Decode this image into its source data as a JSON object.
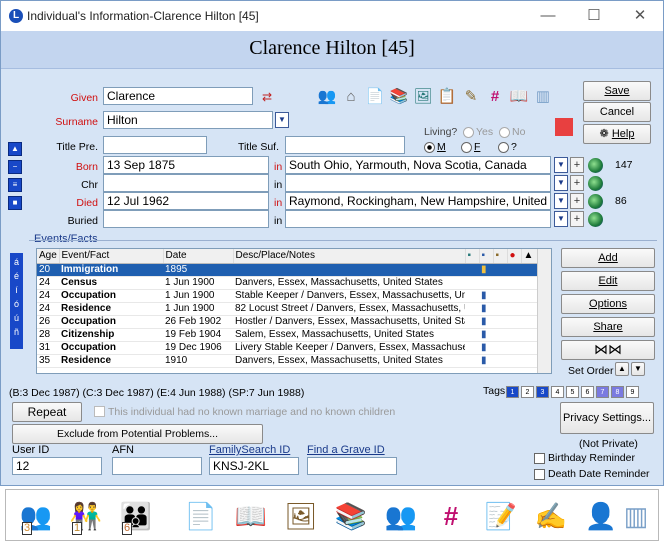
{
  "window": {
    "title": "Individual's Information-Clarence Hilton [45]",
    "banner_name": "Clarence Hilton [45]",
    "minimize": "—",
    "maximize": "☐",
    "close": "✕"
  },
  "person": {
    "given_label": "Given",
    "given_value": "Clarence",
    "surname_label": "Surname",
    "surname_value": "Hilton",
    "title_pre_label": "Title Pre.",
    "title_pre_value": "",
    "title_suf_label": "Title Suf.",
    "title_suf_value": "",
    "living_label": "Living?",
    "living_yes": "Yes",
    "living_no": "No",
    "sex_m": "M",
    "sex_f": "F",
    "sex_unknown": "?"
  },
  "events_top": [
    {
      "label": "Born",
      "date": "13 Sep 1875",
      "in": "in",
      "place": "South Ohio, Yarmouth, Nova Scotia, Canada",
      "count": "147"
    },
    {
      "label": "Chr",
      "date": "",
      "in": "in",
      "place": "",
      "count": ""
    },
    {
      "label": "Died",
      "date": "12 Jul 1962",
      "in": "in",
      "place": "Raymond, Rockingham, New Hampshire, United States",
      "count": "86"
    },
    {
      "label": "Buried",
      "date": "",
      "in": "in",
      "place": "",
      "count": ""
    }
  ],
  "buttons": {
    "save": "Save",
    "cancel": "Cancel",
    "help": "Help",
    "add": "Add",
    "edit": "Edit",
    "options": "Options",
    "share": "Share",
    "set_order": "Set Order",
    "repeat": "Repeat",
    "exclude": "Exclude from Potential Problems...",
    "privacy": "Privacy Settings..."
  },
  "events_section": {
    "title": "Events/Facts",
    "columns": [
      "Age",
      "Event/Fact",
      "Date",
      "Desc/Place/Notes"
    ],
    "rows": [
      {
        "age": "20",
        "event": "Immigration",
        "date": "1895",
        "desc": "",
        "selected": true
      },
      {
        "age": "24",
        "event": "Census",
        "date": "1 Jun 1900",
        "desc": "Danvers, Essex, Massachusetts, United States"
      },
      {
        "age": "24",
        "event": "Occupation",
        "date": "1 Jun 1900",
        "desc": "Stable Keeper / Danvers, Essex, Massachusetts, United"
      },
      {
        "age": "24",
        "event": "Residence",
        "date": "1 Jun 1900",
        "desc": "82 Locust Street / Danvers, Essex, Massachusetts, Unit"
      },
      {
        "age": "26",
        "event": "Occupation",
        "date": "26 Feb 1902",
        "desc": "Hostler / Danvers, Essex, Massachusetts, United States"
      },
      {
        "age": "28",
        "event": "Citizenship",
        "date": "19 Feb 1904",
        "desc": "Salem, Essex, Massachusetts, United States"
      },
      {
        "age": "31",
        "event": "Occupation",
        "date": "19 Dec 1906",
        "desc": "Livery Stable Keeper / Danvers, Essex, Massachusetts,"
      },
      {
        "age": "35",
        "event": "Residence",
        "date": "1910",
        "desc": "Danvers, Essex, Massachusetts, United States"
      }
    ]
  },
  "dates_summary": "(B:3 Dec 1987) (C:3 Dec 1987) (E:4 Jun 1988) (SP:7 Jun 1988)",
  "tags_label": "Tags",
  "tags": [
    "1",
    "2",
    "3",
    "4",
    "5",
    "6",
    "7",
    "8",
    "9"
  ],
  "no_marriage_text": "This individual had no known marriage and no known children",
  "privacy_status": "(Not Private)",
  "birthday_reminder": "Birthday Reminder",
  "death_reminder": "Death Date Reminder",
  "ids": {
    "user_id_label": "User ID",
    "user_id_value": "12",
    "afn_label": "AFN",
    "afn_value": "",
    "familysearch_label": "FamilySearch ID",
    "familysearch_value": "KNSJ-2KL",
    "findagrave_label": "Find a Grave ID",
    "findagrave_value": ""
  },
  "side_letters": [
    "á",
    "é",
    "í",
    "ó",
    "ú",
    "ñ"
  ],
  "bottom_badges": [
    "3",
    "1",
    "6"
  ]
}
